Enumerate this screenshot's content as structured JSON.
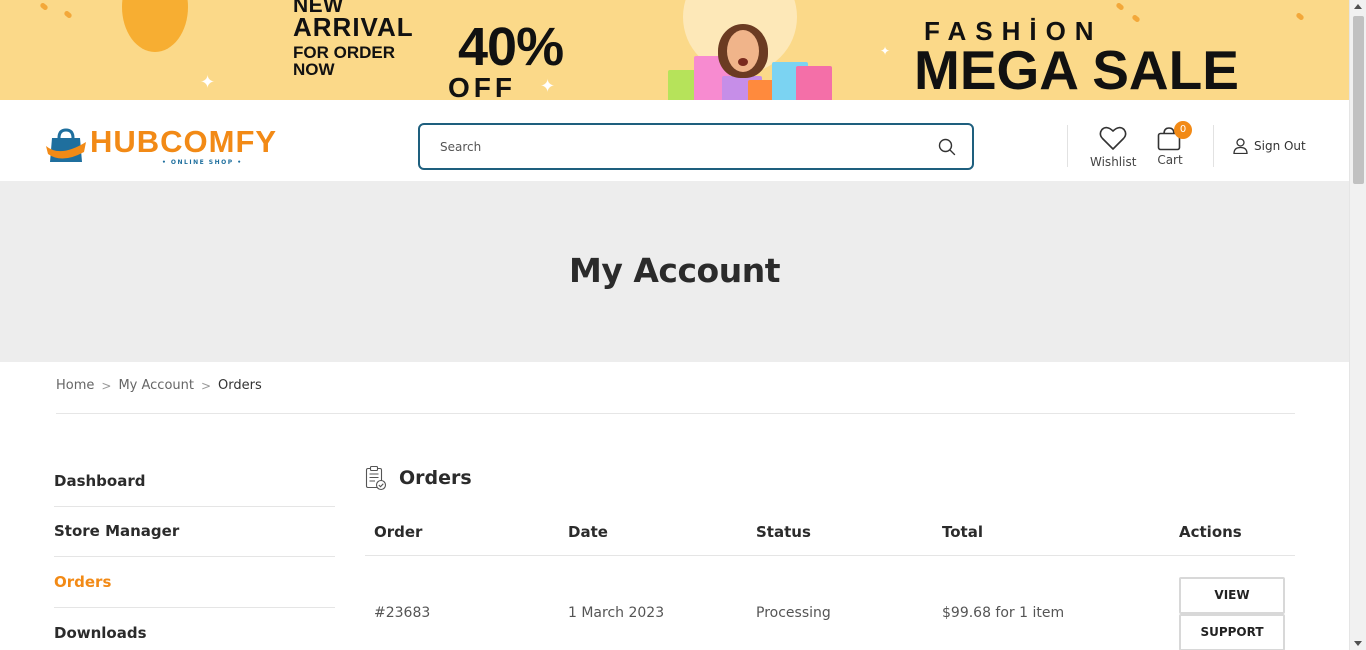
{
  "banner": {
    "new": "NEW",
    "arrival": "ARRIVAL",
    "for_order": "FOR ORDER",
    "now": "NOW",
    "discount": "40%",
    "off": "OFF",
    "fashion": "FASHİON",
    "mega_sale": "MEGA SALE"
  },
  "logo": {
    "name": "HUBCOMFY",
    "tagline": "• ONLINE SHOP •"
  },
  "search": {
    "placeholder": "Search"
  },
  "header": {
    "wishlist": "Wishlist",
    "cart": "Cart",
    "cart_count": "0",
    "sign_out": "Sign Out"
  },
  "hero": {
    "title": "My Account"
  },
  "breadcrumb": {
    "items": [
      "Home",
      "My Account",
      "Orders"
    ],
    "sep": ">"
  },
  "sidebar": {
    "items": [
      "Dashboard",
      "Store Manager",
      "Orders",
      "Downloads"
    ]
  },
  "orders": {
    "title": "Orders",
    "columns": [
      "Order",
      "Date",
      "Status",
      "Total",
      "Actions"
    ],
    "rows": [
      {
        "order": "#23683",
        "date": "1 March 2023",
        "status": "Processing",
        "total": "$99.68 for 1 item",
        "actions": [
          "VIEW",
          "SUPPORT"
        ]
      }
    ]
  },
  "colors": {
    "accent": "#f28a16",
    "search_border": "#1e5f7e",
    "banner_bg": "#fbd989",
    "hero_bg": "#ededed"
  }
}
